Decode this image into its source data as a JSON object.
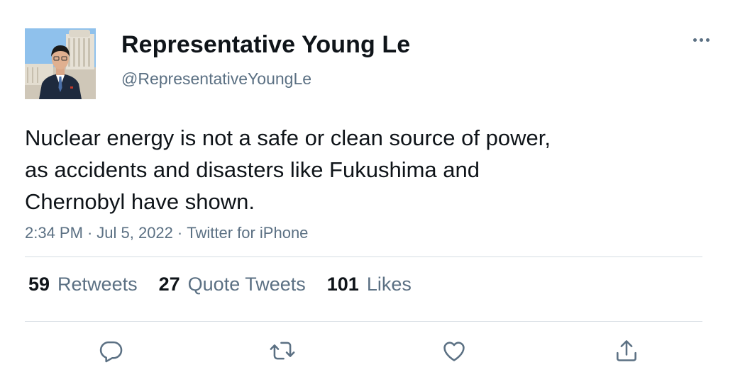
{
  "author": {
    "display_name": "Representative Young Le",
    "handle": "@RepresentativeYoungLe",
    "avatar_icon": "profile-photo"
  },
  "tweet": {
    "text_lines": [
      "Nuclear energy is not a safe or clean source of power,",
      "as accidents and disasters like Fukushima and",
      "Chernobyl have shown."
    ],
    "time": "2:34 PM",
    "date": "Jul 5, 2022",
    "source": "Twitter for iPhone",
    "separator": "·"
  },
  "stats": {
    "retweets": {
      "count": "59",
      "label": "Retweets"
    },
    "quote_tweets": {
      "count": "27",
      "label": "Quote Tweets"
    },
    "likes": {
      "count": "101",
      "label": "Likes"
    }
  },
  "actions": [
    "reply-icon",
    "retweet-icon",
    "like-icon",
    "share-icon"
  ],
  "colors": {
    "text": "#0f1419",
    "secondary": "#5b7083",
    "divider": "#d5dce2",
    "background": "#ffffff"
  }
}
